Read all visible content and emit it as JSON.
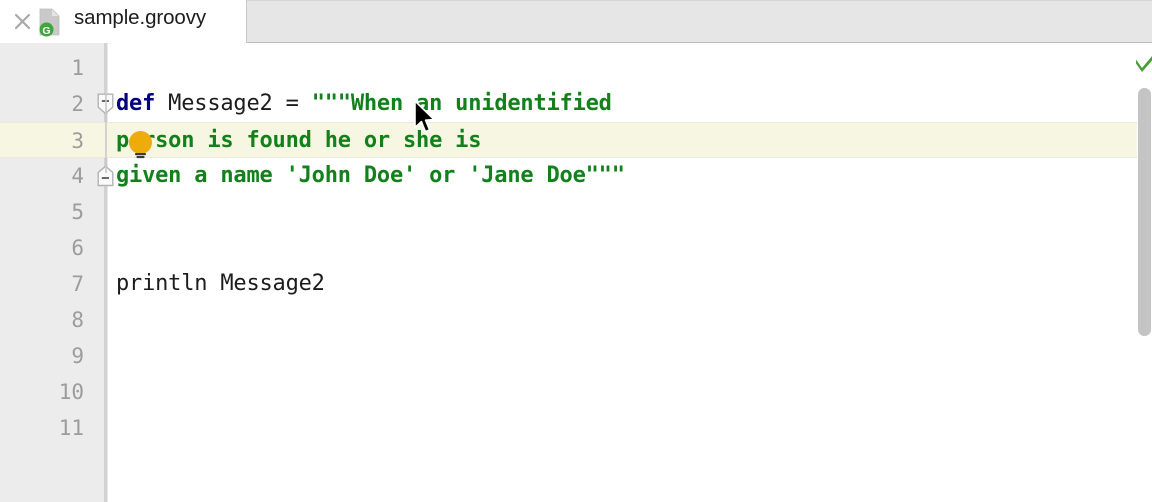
{
  "window": {
    "app": "intellij-idea-editor"
  },
  "tab": {
    "filename": "sample.groovy",
    "close_icon": "close-icon",
    "file_icon": "groovy-file-icon",
    "file_icon_badge": "G"
  },
  "editor": {
    "language": "groovy",
    "caret_line": 3,
    "line_numbers": [
      "1",
      "2",
      "3",
      "4",
      "5",
      "6",
      "7",
      "8",
      "9",
      "10",
      "11"
    ],
    "lines": [
      {
        "num": "1",
        "tokens": []
      },
      {
        "num": "2",
        "tokens": [
          {
            "text": "def",
            "type": "keyword"
          },
          {
            "text": " Message2 = ",
            "type": "plain"
          },
          {
            "text": "\"\"\"When an unidentified",
            "type": "string"
          }
        ]
      },
      {
        "num": "3",
        "tokens": [
          {
            "text": "person is found he or she is",
            "type": "string"
          }
        ]
      },
      {
        "num": "4",
        "tokens": [
          {
            "text": "given a name 'John Doe' or 'Jane Doe\"\"\"",
            "type": "string"
          }
        ]
      },
      {
        "num": "5",
        "tokens": []
      },
      {
        "num": "6",
        "tokens": []
      },
      {
        "num": "7",
        "tokens": [
          {
            "text": "println Message2",
            "type": "plain"
          }
        ]
      },
      {
        "num": "8",
        "tokens": []
      },
      {
        "num": "9",
        "tokens": []
      },
      {
        "num": "10",
        "tokens": []
      },
      {
        "num": "11",
        "tokens": []
      }
    ],
    "line_text": {
      "l1": "",
      "l2_kw": "def",
      "l2_plain": " Message2 = ",
      "l2_str": "\"\"\"When an unidentified",
      "l3_str": "person is found he or she is",
      "l4_str": "given a name 'John Doe' or 'Jane Doe\"\"\"",
      "l7_plain": "println Message2"
    }
  },
  "gutter": {
    "fold_start_icon": "fold-collapse-start-icon",
    "fold_end_icon": "fold-collapse-end-icon"
  },
  "intention": {
    "icon": "lightbulb-icon",
    "color": "#edac09"
  },
  "inspection": {
    "status_icon": "checkmark-ok-icon",
    "status_color": "#4a9e38"
  },
  "scrollbar": {
    "thumb": "vertical-scrollbar-thumb"
  },
  "pointer": {
    "icon": "mouse-pointer-arrow"
  },
  "colors": {
    "keyword": "#000080",
    "string": "#12811b",
    "plain_text": "#1c1c1c",
    "gutter_bg": "#ececec",
    "line_number": "#9c9c9c",
    "caret_line_bg": "#f7f6e2",
    "tab_bar_bg": "#e6e6e6",
    "editor_bg": "#ffffff"
  }
}
